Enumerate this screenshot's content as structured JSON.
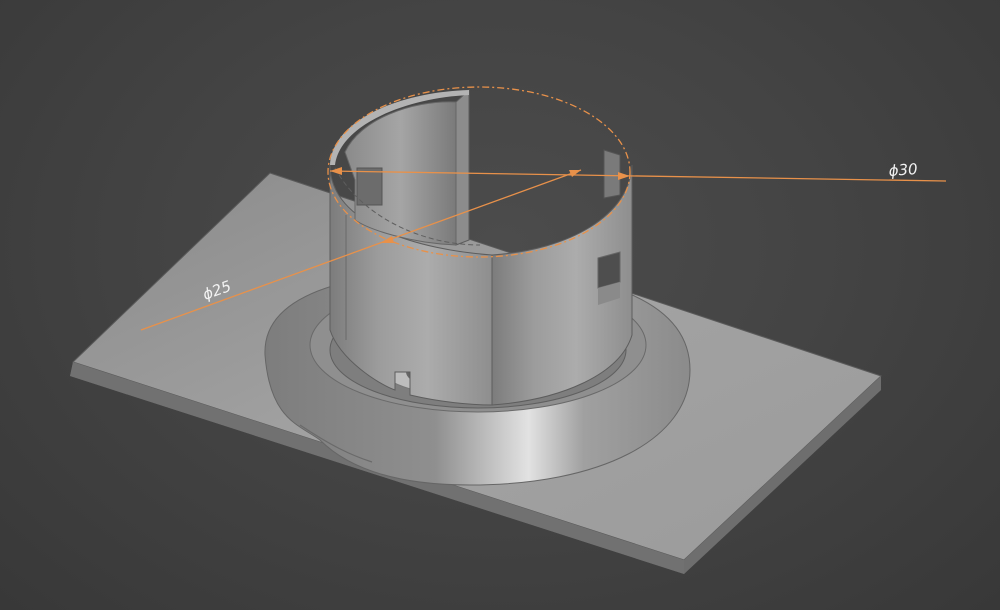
{
  "viewport": {
    "background_color": "#444444",
    "model_color": "#9a9a9a",
    "dimension_color": "#e8914a"
  },
  "dimensions": {
    "outer_diameter_label": "ϕ30",
    "inner_diameter_label": "ϕ25"
  }
}
